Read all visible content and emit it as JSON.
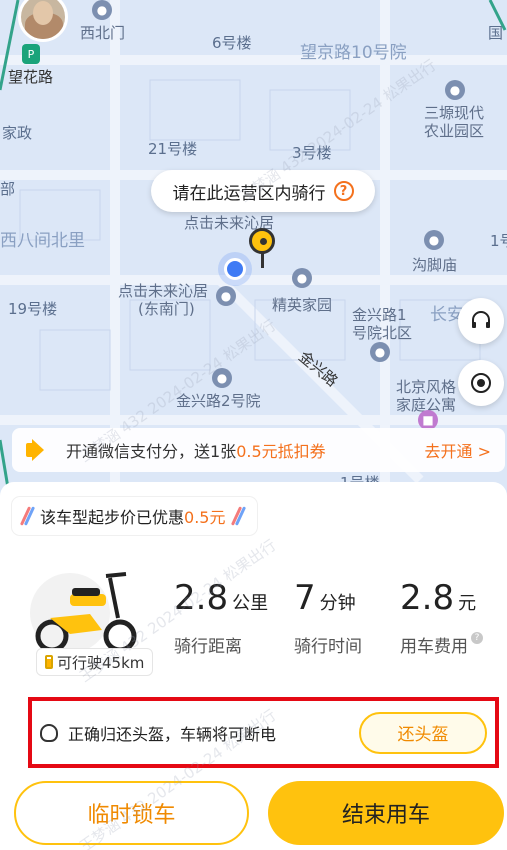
{
  "map": {
    "labels": {
      "xibeimen": "西北门",
      "bld6": "6号楼",
      "wangjing10": "望京路10号院",
      "guo": "国",
      "wanghualu": "望花路",
      "sanbo": "三塬现代",
      "sanbo2": "农业园区",
      "jiazheng": "家政",
      "bld21": "21号楼",
      "bld3": "3号楼",
      "bu": "部",
      "xibalijian": "西八间北里",
      "djwl": "点击未来沁居",
      "yi": "1号",
      "goujiao": "沟脚庙",
      "djwl2": "点击未来沁居",
      "djwl2b": "(东南门)",
      "jingying": "精英家园",
      "jinxing1": "金兴路1",
      "jinxing1b": "号院北区",
      "changan": "长安",
      "bld19": "19号楼",
      "jinxinglu": "金兴路",
      "jinxing2": "金兴路2号院",
      "beijingfg": "北京风格",
      "beijingfg2": "家庭公寓",
      "bld1": "1号楼"
    },
    "tip": "请在此运营区内骑行",
    "tip_icon": "?"
  },
  "promo": {
    "text_before": "开通微信支付分，送1张",
    "highlight": "0.5元抵扣券",
    "cta": "去开通 >"
  },
  "discount": {
    "text": "该车型起步价已优惠",
    "highlight": "0.5元"
  },
  "ride": {
    "range": "可行驶45km",
    "distance_value": "2.8",
    "distance_unit": "公里",
    "distance_label": "骑行距离",
    "time_value": "7",
    "time_unit": "分钟",
    "time_label": "骑行时间",
    "fee_value": "2.8",
    "fee_unit": "元",
    "fee_label": "用车费用"
  },
  "helmet": {
    "text": "正确归还头盔，车辆将可断电",
    "button": "还头盔"
  },
  "actions": {
    "lock": "临时锁车",
    "end": "结束用车"
  },
  "colors": {
    "accent": "#ffc20e",
    "highlight": "#f4711d",
    "alert_border": "#e50914"
  },
  "watermark": "王梦涵 432 2024-02-24 松果出行"
}
